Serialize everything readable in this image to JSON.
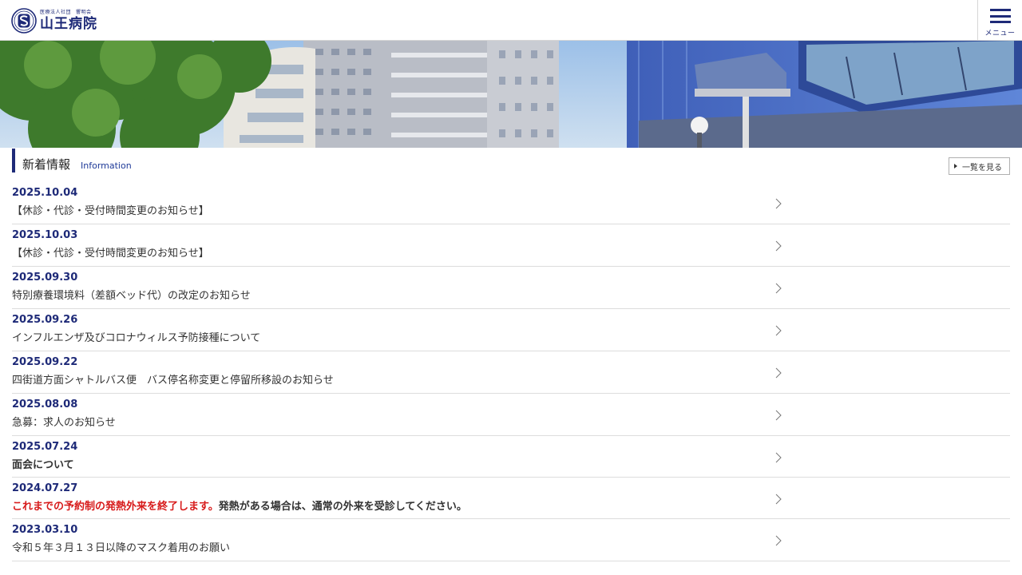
{
  "header": {
    "logo_small_1": "医療法人社団",
    "logo_small_2": "響明会",
    "logo_name": "山王病院",
    "menu_label": "メニュー"
  },
  "section": {
    "title": "新着情報",
    "subtitle": "Information",
    "more_label": "一覧を見る"
  },
  "news": [
    {
      "date": "2025.10.04",
      "title": "【休診・代診・受付時間変更のお知らせ】"
    },
    {
      "date": "2025.10.03",
      "title": "【休診・代診・受付時間変更のお知らせ】"
    },
    {
      "date": "2025.09.30",
      "title": "特別療養環境料（差額ベッド代）の改定のお知らせ"
    },
    {
      "date": "2025.09.26",
      "title": "インフルエンザ及びコロナウィルス予防接種について"
    },
    {
      "date": "2025.09.22",
      "title": "四街道方面シャトルバス便　バス停名称変更と停留所移設のお知らせ"
    },
    {
      "date": "2025.08.08",
      "title": "急募：求人のお知らせ"
    },
    {
      "date": "2025.07.24",
      "title": "面会について"
    },
    {
      "date": "2024.07.27",
      "title_red": "これまでの予約制の発熱外来を終了します。",
      "title_rest": "発熱がある場合は、通常の外来を受診してください。"
    },
    {
      "date": "2023.03.10",
      "title": "令和５年３月１３日以降のマスク着用のお願い"
    }
  ],
  "colors": {
    "brand": "#1e2a78",
    "alert": "#d71a1a"
  }
}
